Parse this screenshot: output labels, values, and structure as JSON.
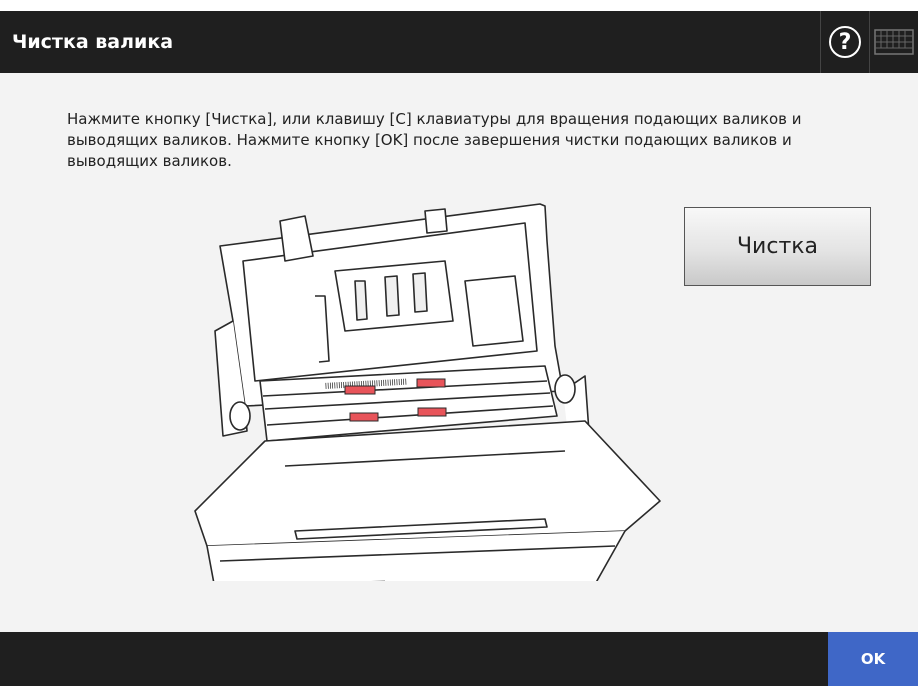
{
  "header": {
    "title": "Чистка валика",
    "help_label": "?",
    "help_icon": "help-icon",
    "keyboard_icon": "keyboard-icon"
  },
  "main": {
    "instruction": "Нажмите кнопку [Чистка], или клавишу [С] клавиатуры для вращения подающих валиков и выводящих валиков. Нажмите кнопку [OK] после завершения чистки подающих валиков и выводящих валиков.",
    "clean_button_label": "Чистка",
    "illustration": "scanner-open-rollers-illustration"
  },
  "footer": {
    "ok_label": "OK"
  },
  "colors": {
    "bar_background": "#1f1f1f",
    "content_background": "#f3f3f3",
    "ok_button": "#3f67c7",
    "roller_highlight": "#e8545a"
  }
}
